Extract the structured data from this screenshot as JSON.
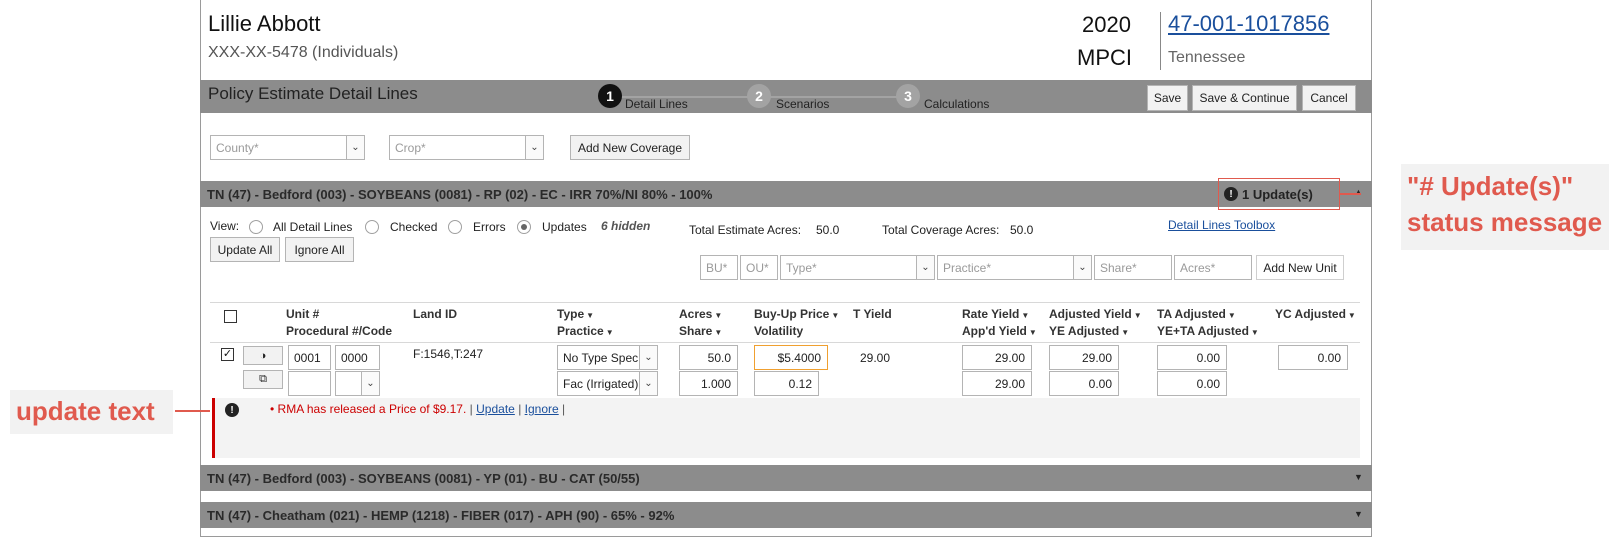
{
  "header": {
    "name": "Lillie Abbott",
    "ssn": "XXX-XX-5478 (Individuals)",
    "year": "2020",
    "program": "MPCI",
    "policy_number": "47-001-1017856",
    "state": "Tennessee"
  },
  "toolbar": {
    "title": "Policy Estimate Detail Lines",
    "steps": [
      {
        "number": "1",
        "label": "Detail Lines"
      },
      {
        "number": "2",
        "label": "Scenarios"
      },
      {
        "number": "3",
        "label": "Calculations"
      }
    ],
    "save": "Save",
    "save_continue": "Save & Continue",
    "cancel": "Cancel"
  },
  "filters": {
    "county_placeholder": "County*",
    "crop_placeholder": "Crop*",
    "add_new_coverage": "Add New Coverage"
  },
  "coverages": [
    {
      "title": "TN (47) - Bedford (003) - SOYBEANS (0081) - RP (02) - EC - IRR 70%/NI 80% - 100%",
      "updates": "1 Update(s)",
      "caret": "▲"
    },
    {
      "title": "TN (47) - Bedford (003) - SOYBEANS (0081) - YP (01) - BU - CAT (50/55)",
      "caret": "▼"
    },
    {
      "title": "TN (47) - Cheatham (021) - HEMP (1218) - FIBER (017) - APH (90) - 65% - 92%",
      "caret": "▼"
    }
  ],
  "view": {
    "label": "View:",
    "options": [
      "All Detail Lines",
      "Checked",
      "Errors",
      "Updates"
    ],
    "hidden": "6 hidden",
    "update_all": "Update All",
    "ignore_all": "Ignore All"
  },
  "totals": {
    "estimate_label": "Total Estimate Acres:",
    "estimate_value": "50.0",
    "coverage_label": "Total Coverage Acres:",
    "coverage_value": "50.0",
    "toolbox_link": "Detail Lines Toolbox"
  },
  "unit_form": {
    "bu": "BU*",
    "ou": "OU*",
    "type": "Type*",
    "practice": "Practice*",
    "share": "Share*",
    "acres": "Acres*",
    "add_new_unit": "Add New Unit"
  },
  "columns": {
    "unit": "Unit #",
    "procedural": "Procedural #/Code",
    "land_id": "Land ID",
    "type": "Type",
    "practice": "Practice",
    "acres": "Acres",
    "share": "Share",
    "buyup": "Buy-Up Price",
    "volatility": "Volatility",
    "tyield": "T Yield",
    "rate_yield": "Rate Yield",
    "appd_yield": "App'd Yield",
    "adj_yield": "Adjusted Yield",
    "ye_adjusted": "YE Adjusted",
    "ta_adjusted": "TA Adjusted",
    "ye_ta_adjusted": "YE+TA Adjusted",
    "yc_adjusted": "YC Adjusted"
  },
  "row": {
    "unit": "0001",
    "unit_suffix": "0000",
    "land_id": "F:1546,T:247",
    "type": "No Type Spec",
    "practice": "Fac (Irrigated)",
    "acres": "50.0",
    "share": "1.000",
    "buyup": "$5.4000",
    "volatility": "0.12",
    "tyield": "29.00",
    "rate_yield": "29.00",
    "appd_yield": "29.00",
    "adj_yield": "29.00",
    "ye_adjusted": "0.00",
    "ta_adjusted": "0.00",
    "ye_ta_adjusted": "0.00",
    "yc_adjusted": "0.00"
  },
  "update_message": {
    "text": "RMA has released a Price of $9.17.",
    "update_link": "Update",
    "ignore_link": "Ignore",
    "separator": "|"
  },
  "annotations": {
    "status_line1": "\"# Update(s)\"",
    "status_line2": "status message",
    "update_text": "update text"
  },
  "colors": {
    "bar": "#8c8c8c",
    "accent_red": "#e05a4e",
    "error_red": "#cc0000",
    "link_blue": "#1a4f9c",
    "highlight_orange": "#f0a030"
  }
}
